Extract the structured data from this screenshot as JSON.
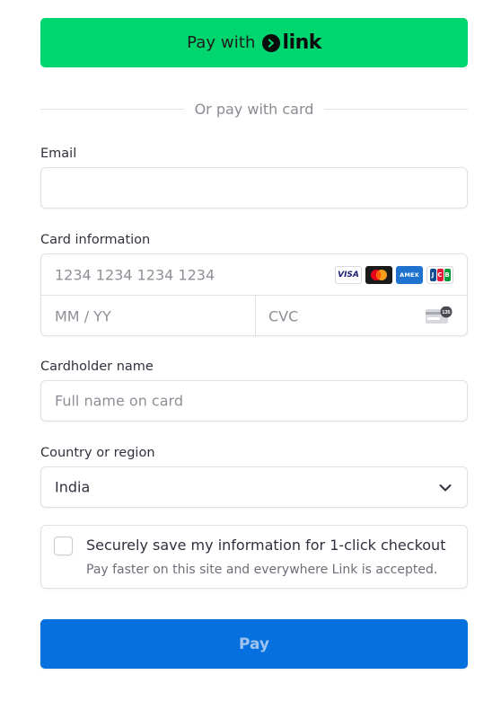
{
  "link_button": {
    "prefix": "Pay with",
    "brand": "link",
    "color": "#00d66f"
  },
  "divider": {
    "text": "Or pay with card"
  },
  "email": {
    "label": "Email",
    "value": ""
  },
  "card": {
    "label": "Card information",
    "number_placeholder": "1234 1234 1234 1234",
    "expiry_placeholder": "MM / YY",
    "cvc_placeholder": "CVC",
    "brands": [
      "visa-icon",
      "mastercard-icon",
      "amex-icon",
      "jcb-icon"
    ],
    "visa_text": "VISA",
    "amex_text": "AMEX",
    "cvc_icon_text": "135"
  },
  "cardholder": {
    "label": "Cardholder name",
    "placeholder": "Full name on card"
  },
  "country": {
    "label": "Country or region",
    "value": "India"
  },
  "save": {
    "title": "Securely save my information for 1-click checkout",
    "subtitle": "Pay faster on this site and everywhere Link is accepted.",
    "checked": false
  },
  "pay_button": {
    "label": "Pay",
    "color": "#0570de"
  }
}
